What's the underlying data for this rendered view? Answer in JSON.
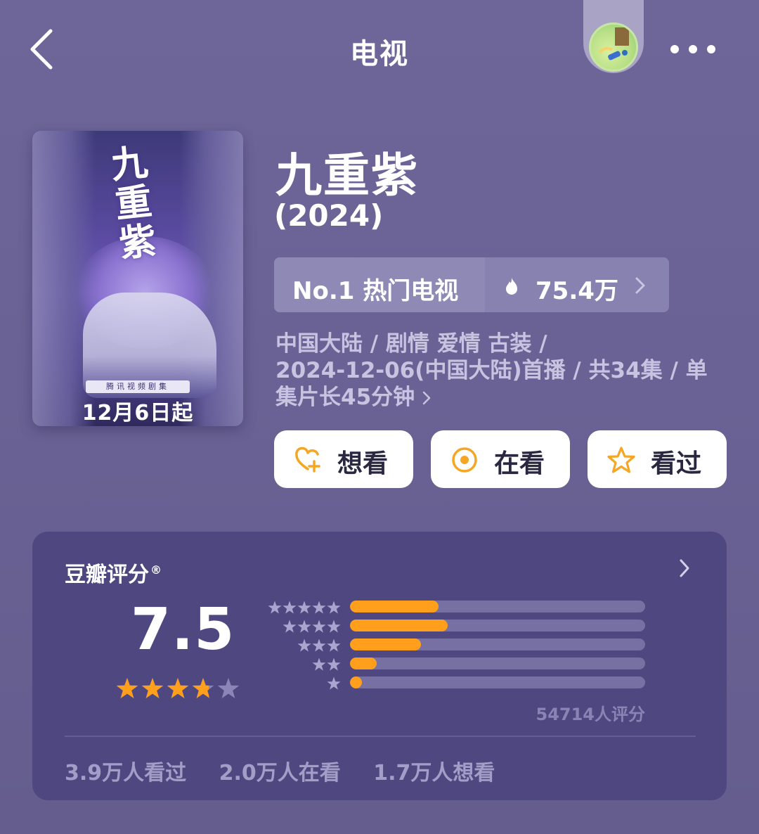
{
  "nav": {
    "title": "电视"
  },
  "poster": {
    "calligraphy": "九重紫",
    "tagline": "腾讯视频剧集",
    "date": "12月6日起"
  },
  "show": {
    "title": "九重紫",
    "year": "(2024)",
    "rank": "No.1 热门电视",
    "heat": "75.4万",
    "meta_line1": "中国大陆 / 剧情 爱情 古装 /",
    "meta_line2": "2024-12-06(中国大陆)首播 / 共34集 / 单",
    "meta_line3": "集片长45分钟"
  },
  "actions": {
    "want": "想看",
    "watching": "在看",
    "watched": "看过"
  },
  "rating": {
    "title": "豆瓣评分",
    "registered": "®",
    "score": "7.5",
    "stars": 3.75,
    "distribution": [
      {
        "stars": 5,
        "fraction": 0.3
      },
      {
        "stars": 4,
        "fraction": 0.33
      },
      {
        "stars": 3,
        "fraction": 0.24
      },
      {
        "stars": 2,
        "fraction": 0.09
      },
      {
        "stars": 1,
        "fraction": 0.04
      }
    ],
    "count": "54714人评分",
    "watched": "3.9万人看过",
    "watching": "2.0万人在看",
    "want": "1.7万人想看"
  },
  "colors": {
    "background": "#6a6294",
    "card": "#4f4880",
    "accent_orange": "#ff9f1c",
    "bar_track": "#7670a3"
  }
}
